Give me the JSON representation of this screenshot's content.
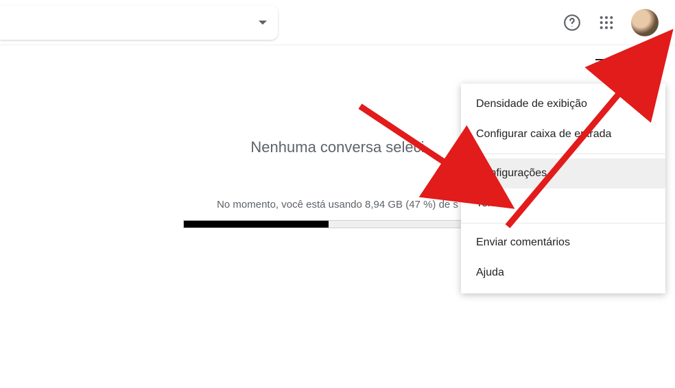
{
  "main": {
    "empty_state": "Nenhuma conversa seleci",
    "storage_text": "No momento, você está usando 8,94 GB (47 %) de s",
    "progress_percent": 47
  },
  "menu": {
    "items": [
      "Densidade de exibição",
      "Configurar caixa de entrada",
      "Configurações",
      "Temas",
      "Enviar comentários",
      "Ajuda"
    ],
    "highlight_index": 2
  },
  "icons": {
    "help": "help-icon",
    "apps": "apps-grid-icon",
    "gear": "gear-icon",
    "density": "density-icon",
    "dropdown": "chevron-down-icon"
  }
}
